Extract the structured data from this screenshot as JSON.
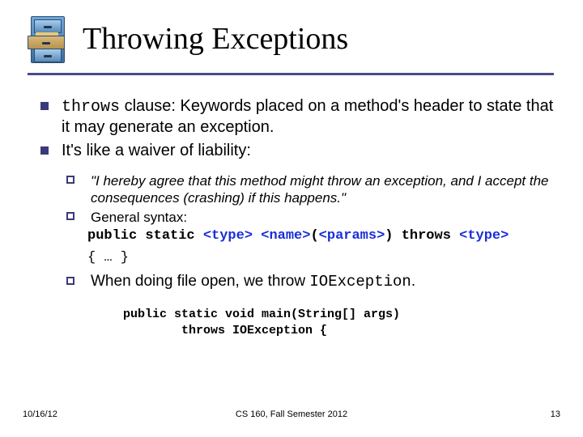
{
  "title": "Throwing Exceptions",
  "bullets": {
    "l1a_kw": "throws",
    "l1a_rest": " clause: Keywords placed on a method's header to state that it may generate an exception.",
    "l1b": "It's like a waiver of liability:"
  },
  "subs": {
    "q1": "\"I hereby agree that this method might throw an exception, and I accept the consequences (crashing) if this happens.\"",
    "q2_lead": "General syntax:",
    "syntax_plain1": "public static ",
    "syntax_type": "<type>",
    "syntax_space1": " ",
    "syntax_name": "<name>",
    "syntax_paren_open": "(",
    "syntax_params": "<params>",
    "syntax_paren_close": ") ",
    "syntax_throws": "throws ",
    "syntax_type2": "<type>",
    "braces": "{ … }",
    "q3_lead": "When doing file open, we throw ",
    "q3_exc": "IOException",
    "q3_dot": "."
  },
  "code": {
    "line1": "public static void main(String[] args)",
    "line2_indent": "        throws IOException {"
  },
  "footer": {
    "date": "10/16/12",
    "center": "CS 160, Fall Semester 2012",
    "page": "13"
  }
}
